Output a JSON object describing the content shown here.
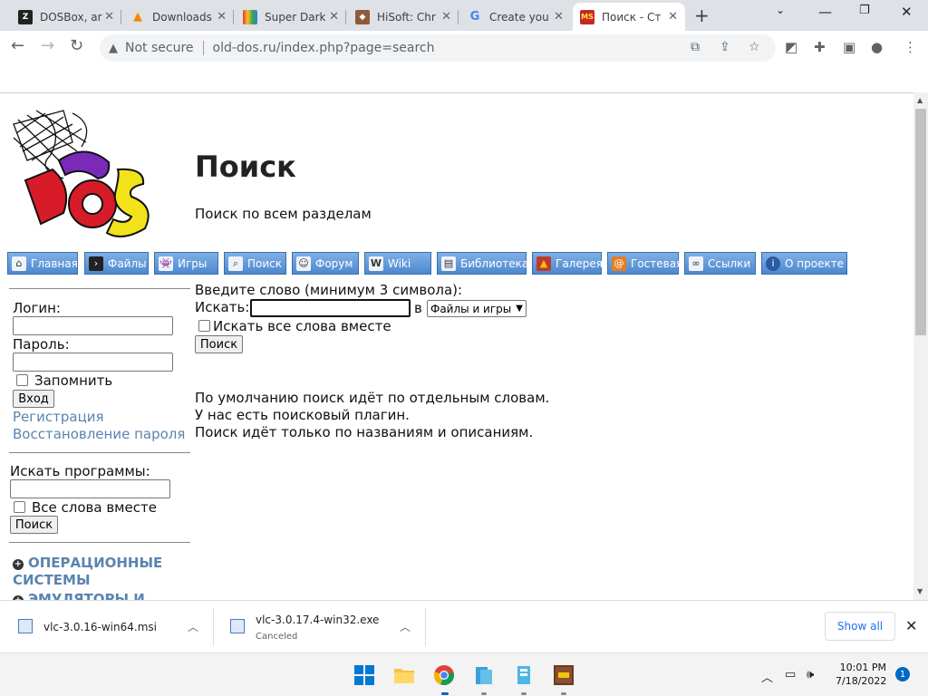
{
  "browser": {
    "tabs": [
      {
        "title": "DOSBox, ar",
        "icon": "dosbox-favicon"
      },
      {
        "title": "Downloads",
        "icon": "vlc-favicon"
      },
      {
        "title": "Super Dark",
        "icon": "rainbow-favicon"
      },
      {
        "title": "HiSoft: Chr",
        "icon": "hisoft-favicon"
      },
      {
        "title": "Create you",
        "icon": "google-favicon"
      },
      {
        "title": "Поиск - Ст",
        "icon": "msdos-favicon",
        "active": true
      }
    ],
    "address": {
      "security_label": "Not secure",
      "url": "old-dos.ru/index.php?page=search"
    }
  },
  "site": {
    "title": "Поиск",
    "subtitle": "Поиск по всем разделам",
    "nav": [
      {
        "label": "Главная",
        "icon": "home-icon"
      },
      {
        "label": "Файлы",
        "icon": "terminal-icon"
      },
      {
        "label": "Игры",
        "icon": "invader-icon"
      },
      {
        "label": "Поиск",
        "icon": "magnifier-icon"
      },
      {
        "label": "Форум",
        "icon": "user-icon"
      },
      {
        "label": "Wiki",
        "icon": "wiki-icon"
      },
      {
        "label": "Библиотека",
        "icon": "book-icon"
      },
      {
        "label": "Галерея",
        "icon": "picture-icon"
      },
      {
        "label": "Гостевая",
        "icon": "guestbook-icon"
      },
      {
        "label": "Ссылки",
        "icon": "link-icon"
      },
      {
        "label": "О проекте",
        "icon": "info-icon"
      }
    ]
  },
  "login": {
    "login_label": "Логин:",
    "password_label": "Пароль:",
    "remember_label": "Запомнить",
    "submit_label": "Вход",
    "register_link": "Регистрация",
    "recover_link": "Восстановление пароля"
  },
  "side_search": {
    "label": "Искать программы:",
    "all_words_label": "Все слова вместе",
    "button": "Поиск"
  },
  "categories": [
    "ОПЕРАЦИОННЫЕ СИСТЕМЫ",
    "ЭМУЛЯТОРЫ И"
  ],
  "search_form": {
    "prompt": "Введите слово (минимум 3 символа):",
    "search_label": "Искать:",
    "in_label": "в",
    "scope_selected": "Файлы и игры",
    "all_words_label": "Искать все слова вместе",
    "button": "Поиск"
  },
  "info": [
    "По умолчанию поиск идёт по отдельным словам.",
    "У нас есть поисковый плагин.",
    "Поиск идёт только по названиям и описаниям."
  ],
  "downloads": {
    "items": [
      {
        "name": "vlc-3.0.16-win64.msi",
        "status": ""
      },
      {
        "name": "vlc-3.0.17.4-win32.exe",
        "status": "Canceled"
      }
    ],
    "show_all": "Show all"
  },
  "taskbar": {
    "time": "10:01 PM",
    "date": "7/18/2022",
    "notification_count": "1"
  }
}
